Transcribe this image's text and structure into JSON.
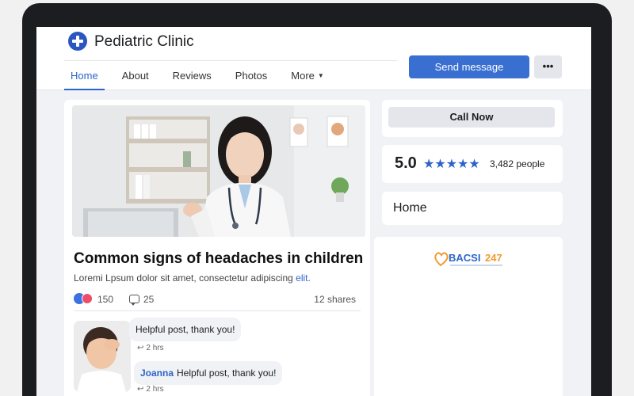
{
  "page": {
    "name": "Pediatric Clinic",
    "tabs": [
      "Home",
      "About",
      "Reviews",
      "Photos",
      "More"
    ],
    "active_tab": "Home",
    "send_message": "Send message",
    "more_menu": "•••"
  },
  "post": {
    "title": "Common signs of headaches in children",
    "body": "Loremi Lpsum dolor sit amet, consectetur adipiscing",
    "body_link": "elit.",
    "likes": "150",
    "comments": "25",
    "shares": "12 shares",
    "comments_list": [
      {
        "author": "",
        "text": "Helpful post, thank you!",
        "time": "2 hrs"
      },
      {
        "author": "Joanna",
        "text": "Helpful post, thank you!",
        "time": "2 hrs"
      }
    ]
  },
  "sidebar": {
    "call_now": "Call Now",
    "rating": "5.0",
    "stars": "★★★★★",
    "rating_count": "3,482 people",
    "home_label": "Home",
    "brand": "BACSI247"
  },
  "colors": {
    "accent": "#3a6fd2",
    "link": "#2e64c9",
    "love": "#ec4d68",
    "brand_orange": "#f29a2e"
  }
}
